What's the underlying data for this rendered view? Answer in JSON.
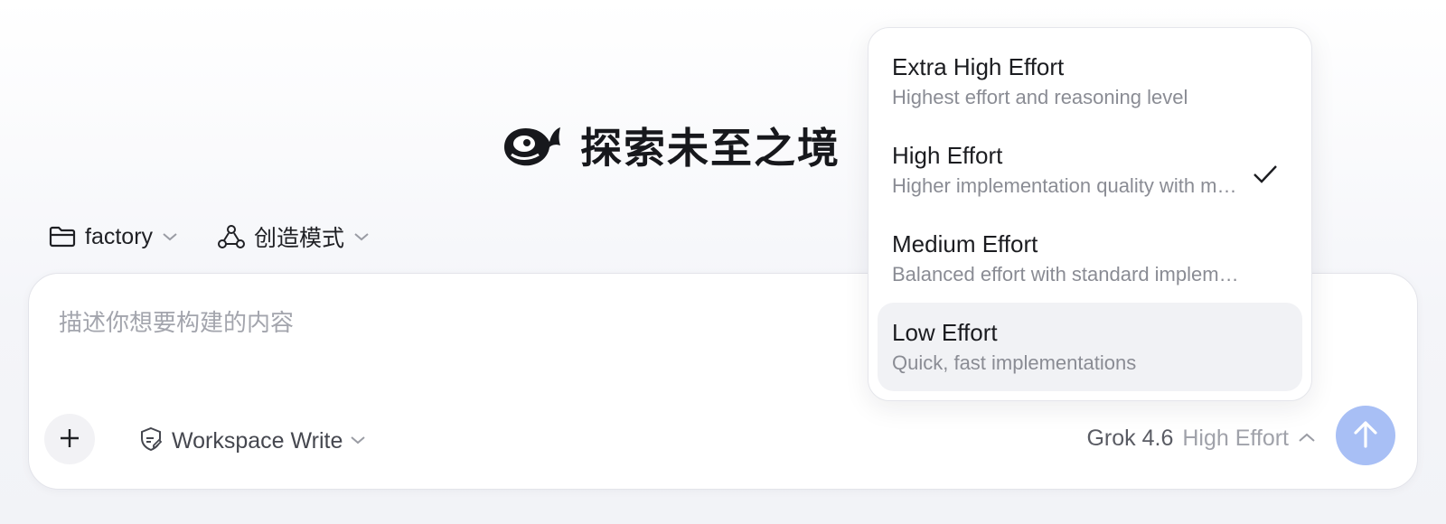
{
  "hero": {
    "title": "探索未至之境"
  },
  "selectors": {
    "folder": {
      "label": "factory"
    },
    "mode": {
      "label": "创造模式"
    }
  },
  "composer": {
    "placeholder": "描述你想要构建的内容",
    "permission": "Workspace Write",
    "model": "Grok 4.6",
    "effort": "High Effort"
  },
  "effort_menu": {
    "items": [
      {
        "title": "Extra High Effort",
        "desc": "Highest effort and reasoning level"
      },
      {
        "title": "High Effort",
        "desc": "Higher implementation quality with more reasoning",
        "checked": true
      },
      {
        "title": "Medium Effort",
        "desc": "Balanced effort with standard implementation"
      },
      {
        "title": "Low Effort",
        "desc": "Quick, fast implementations",
        "hovered": true
      }
    ]
  },
  "colors": {
    "send_button": "#a8bff5",
    "hover_row": "#f1f2f5",
    "placeholder": "#a3a5ad"
  }
}
